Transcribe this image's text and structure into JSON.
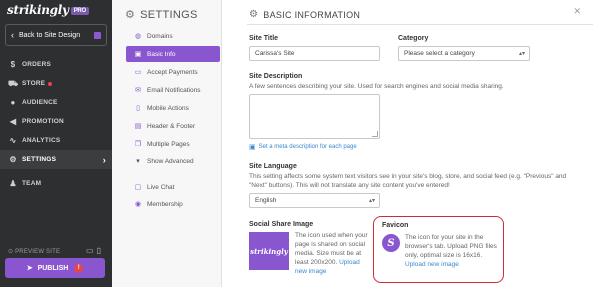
{
  "brand": {
    "name": "strikingly",
    "badge": "PRO"
  },
  "nav": {
    "back_label": "Back to Site Design",
    "items": [
      {
        "label": "ORDERS",
        "icon": "dollar-icon"
      },
      {
        "label": "STORE",
        "icon": "cart-icon"
      },
      {
        "label": "AUDIENCE",
        "icon": "people-icon"
      },
      {
        "label": "PROMOTION",
        "icon": "megaphone-icon"
      },
      {
        "label": "ANALYTICS",
        "icon": "chart-icon"
      },
      {
        "label": "SETTINGS",
        "icon": "gear-icon"
      },
      {
        "label": "TEAM",
        "icon": "team-icon"
      }
    ],
    "active": "SETTINGS",
    "preview_label": "PREVIEW SITE",
    "publish_label": "PUBLISH",
    "publish_badge": "!"
  },
  "settings": {
    "title": "SETTINGS",
    "items": [
      {
        "label": "Domains",
        "icon": "globe-icon"
      },
      {
        "label": "Basic Info",
        "icon": "info-icon"
      },
      {
        "label": "Accept Payments",
        "icon": "card-icon"
      },
      {
        "label": "Email Notifications",
        "icon": "envelope-icon"
      },
      {
        "label": "Mobile Actions",
        "icon": "phone-icon"
      },
      {
        "label": "Header & Footer",
        "icon": "header-icon"
      },
      {
        "label": "Multiple Pages",
        "icon": "pages-icon"
      },
      {
        "label": "Show Advanced",
        "icon": "chevron-down-icon"
      },
      {
        "label": "Live Chat",
        "icon": "chat-icon"
      },
      {
        "label": "Membership",
        "icon": "member-icon"
      }
    ],
    "active": "Basic Info"
  },
  "main": {
    "title": "BASIC INFORMATION",
    "site_title": {
      "label": "Site Title",
      "value": "Carissa's Site"
    },
    "category": {
      "label": "Category",
      "value": "Please select a category"
    },
    "site_description": {
      "label": "Site Description",
      "help": "A few sentences describing your site. Used for search engines and social media sharing.",
      "value": "",
      "meta_link": "Set a meta description for each page"
    },
    "site_language": {
      "label": "Site Language",
      "help": "This setting affects some system text visitors see in your site's blog, store, and social feed (e.g. \"Previous\" and \"Next\" buttons). This will not translate any site content you've entered!",
      "value": "English"
    },
    "social_share": {
      "label": "Social Share Image",
      "thumb_text": "strikingly",
      "help": "The icon used when your page is shared on social media. Size must be at least 200x200.",
      "link": "Upload new image"
    },
    "favicon": {
      "label": "Favicon",
      "icon_letter": "S",
      "help": "The icon for your site in the browser's tab. Upload PNG files only, optimal size is 16x16.",
      "link": "Upload new image"
    }
  },
  "colors": {
    "accent": "#8a56d0",
    "sidebar": "#2e2f31",
    "highlight": "#d02a37",
    "link": "#3a88d0"
  }
}
